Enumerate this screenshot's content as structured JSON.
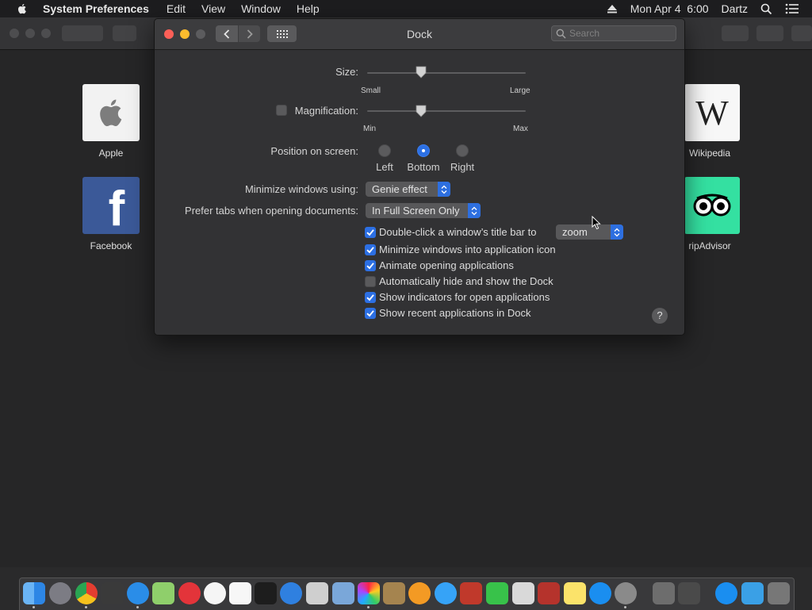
{
  "menubar": {
    "app_name": "System Preferences",
    "items": [
      "Edit",
      "View",
      "Window",
      "Help"
    ],
    "clock": "Mon Apr 4  6:00",
    "user": "Dartz"
  },
  "favorites": [
    {
      "label": "Apple"
    },
    {
      "label": "Facebook"
    },
    {
      "label": "Wikipedia"
    },
    {
      "label": "ripAdvisor"
    }
  ],
  "window": {
    "title": "Dock",
    "search_placeholder": "Search"
  },
  "size": {
    "label": "Size:",
    "min_label": "Small",
    "max_label": "Large",
    "value_fraction": 0.34
  },
  "magnification": {
    "label": "Magnification:",
    "checked": false,
    "min_label": "Min",
    "max_label": "Max",
    "value_fraction": 0.34
  },
  "position": {
    "label": "Position on screen:",
    "options": [
      "Left",
      "Bottom",
      "Right"
    ],
    "selected": "Bottom"
  },
  "minimize": {
    "label": "Minimize windows using:",
    "value": "Genie effect"
  },
  "prefer_tabs": {
    "label": "Prefer tabs when opening documents:",
    "value": "In Full Screen Only"
  },
  "double_click": {
    "label": "Double-click a window’s title bar to",
    "checked": true,
    "value": "zoom"
  },
  "checkboxes": [
    {
      "label": "Minimize windows into application icon",
      "checked": true
    },
    {
      "label": "Animate opening applications",
      "checked": true
    },
    {
      "label": "Automatically hide and show the Dock",
      "checked": false
    },
    {
      "label": "Show indicators for open applications",
      "checked": true
    },
    {
      "label": "Show recent applications in Dock",
      "checked": true
    }
  ],
  "help_label": "?",
  "colors": {
    "accent": "#2c70e4",
    "close": "#fc5f57",
    "minimize": "#fdbc2e",
    "zoom_disabled": "#5c5c5e"
  }
}
